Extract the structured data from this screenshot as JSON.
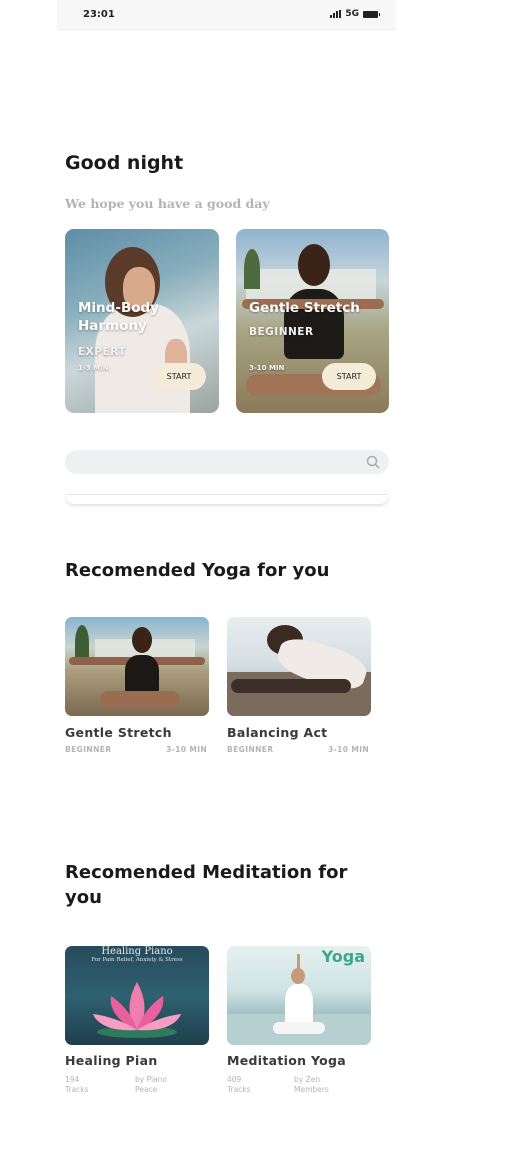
{
  "status": {
    "time": "23:01",
    "network": "5G"
  },
  "greeting": {
    "title": "Good night",
    "subtitle": "We hope you have a good day"
  },
  "hero_cards": [
    {
      "title_line1": "Mind-Body",
      "title_line2": "Harmony",
      "level": "EXPERT",
      "duration": "1-3 MIN",
      "button": "START"
    },
    {
      "title_line1": "Gentle Stretch",
      "level": "BEGINNER",
      "duration": "3-10 MIN",
      "button": "START"
    }
  ],
  "sections": {
    "yoga_title": "Recomended Yoga for you",
    "meditation_title_line1": "Recomended Meditation for",
    "meditation_title_line2": "you"
  },
  "yoga": [
    {
      "title": "Gentle Stretch",
      "level": "BEGINNER",
      "duration": "3-10 MIN"
    },
    {
      "title": "Balancing Act",
      "level": "BEGINNER",
      "duration": "3-10 MIN"
    }
  ],
  "meditation": [
    {
      "title": "Healing Pian",
      "tracks_num": "194",
      "tracks_label": "Tracks",
      "by_line1": "by Piano",
      "by_line2": "Peace",
      "cover_title": "Healing Piano",
      "cover_sub": "For Pain Relief, Anxiety & Stress"
    },
    {
      "title": "Meditation Yoga",
      "tracks_num": "409",
      "tracks_label": "Tracks",
      "by_line1": "by Zen",
      "by_line2": "Members",
      "cover_title": "Yoga"
    }
  ],
  "colors": {
    "accent_button": "#f4ebd9",
    "search_bg": "#eef0f1",
    "yoga_green": "#3aa68a"
  }
}
